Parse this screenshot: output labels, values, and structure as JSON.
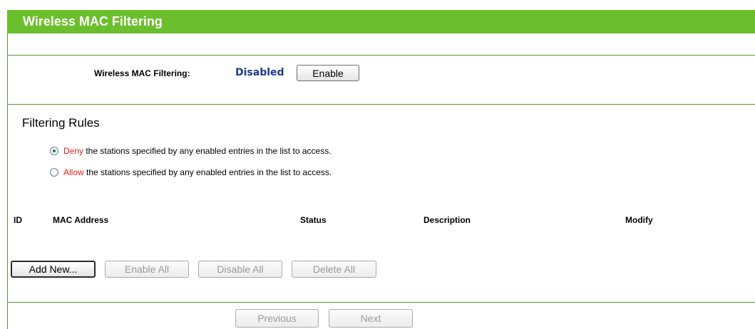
{
  "title": "Wireless MAC Filtering",
  "filtering": {
    "label": "Wireless MAC Filtering:",
    "state": "Disabled",
    "enable_button": "Enable"
  },
  "rules": {
    "heading": "Filtering Rules",
    "options": [
      {
        "keyword": "Deny",
        "text": " the stations specified by any enabled entries in the list to access.",
        "selected": true
      },
      {
        "keyword": "Allow",
        "text": " the stations specified by any enabled entries in the list to access.",
        "selected": false
      }
    ]
  },
  "table": {
    "headers": [
      "ID",
      "MAC Address",
      "Status",
      "Description",
      "Modify"
    ]
  },
  "actions": {
    "add_new": "Add New...",
    "enable_all": "Enable All",
    "disable_all": "Disable All",
    "delete_all": "Delete All"
  },
  "pager": {
    "previous": "Previous",
    "next": "Next"
  },
  "colors": {
    "title_bar": "#6cbf2c",
    "divider": "#4f9c2e",
    "state_text": "#1b3a8c",
    "keyword": "#e2211c"
  }
}
